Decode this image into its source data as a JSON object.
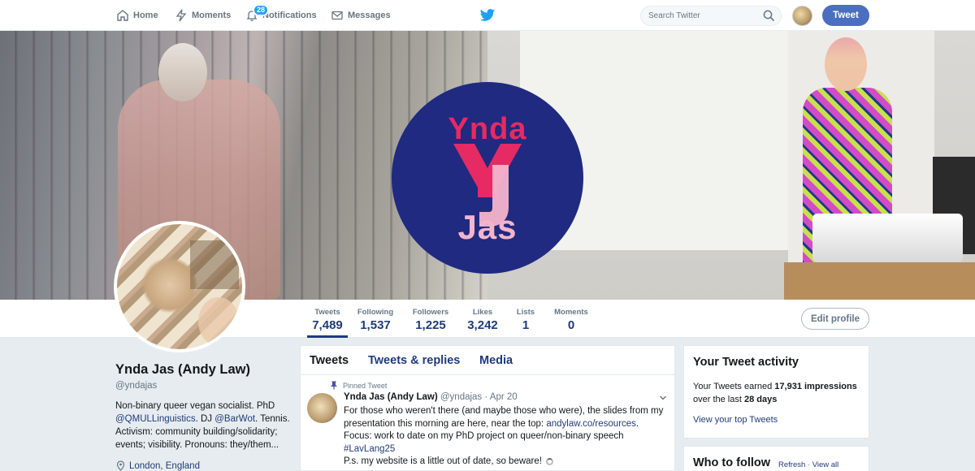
{
  "nav": {
    "home": "Home",
    "moments": "Moments",
    "notifications": "Notifications",
    "notifications_count": "28",
    "messages": "Messages",
    "search_placeholder": "Search Twitter",
    "tweet_button": "Tweet"
  },
  "banner": {
    "logo_top": "Ynda",
    "logo_bottom": "Jas"
  },
  "stats": [
    {
      "label": "Tweets",
      "value": "7,489"
    },
    {
      "label": "Following",
      "value": "1,537"
    },
    {
      "label": "Followers",
      "value": "1,225"
    },
    {
      "label": "Likes",
      "value": "3,242"
    },
    {
      "label": "Lists",
      "value": "1"
    },
    {
      "label": "Moments",
      "value": "0"
    }
  ],
  "edit_profile": "Edit profile",
  "profile": {
    "name": "Ynda Jas (Andy Law)",
    "handle": "@yndajas",
    "bio_1": "Non-binary queer vegan socialist. PhD",
    "bio_mention_1": "@QMULLinguistics",
    "bio_2": ". DJ ",
    "bio_mention_2": "@BarWot",
    "bio_3": ". Tennis. Activism: community building/solidarity; events; visibility. Pronouns: they/them...",
    "location": "London, England"
  },
  "timeline": {
    "tabs": [
      "Tweets",
      "Tweets & replies",
      "Media"
    ],
    "pinned_label": "Pinned Tweet",
    "tweet": {
      "name": "Ynda Jas (Andy Law)",
      "handle": "@yndajas",
      "date": "· Apr 20",
      "body_1": "For those who weren't there (and maybe those who were), the slides from my presentation this morning are here, near the top: ",
      "body_link": "andylaw.co/resources",
      "body_2": ". Focus: work to date on my PhD project on queer/non-binary speech ",
      "body_hashtag": "#LavLang25",
      "body_3": "P.s. my website is a little out of date, so beware!"
    }
  },
  "activity": {
    "title": "Your Tweet activity",
    "text_1": "Your Tweets earned ",
    "impressions": "17,931 impressions",
    "text_2": " over the last ",
    "period": "28 days",
    "link": "View your top Tweets"
  },
  "who_to_follow": {
    "title": "Who to follow",
    "refresh": "Refresh",
    "separator": "·",
    "view_all": "View all"
  }
}
